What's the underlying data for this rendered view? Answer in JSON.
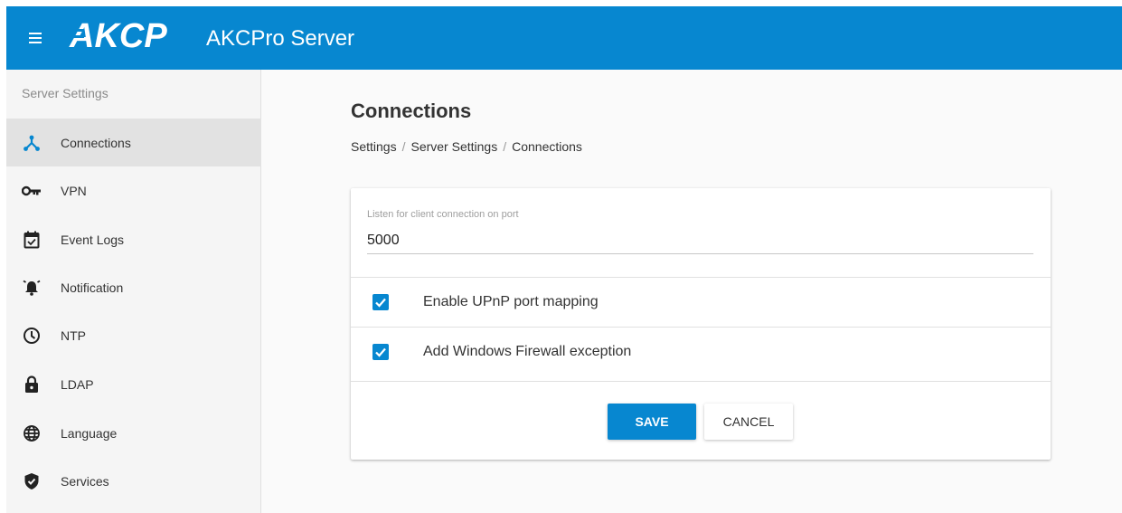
{
  "app": {
    "logo_text": "AKCP",
    "title": "AKCPro Server",
    "brand_color": "#0787d0"
  },
  "sidebar": {
    "header": "Server Settings",
    "items": [
      {
        "label": "Connections",
        "icon": "connections-icon",
        "active": true
      },
      {
        "label": "VPN",
        "icon": "key-icon",
        "active": false
      },
      {
        "label": "Event Logs",
        "icon": "calendar-check-icon",
        "active": false
      },
      {
        "label": "Notification",
        "icon": "alarm-bell-icon",
        "active": false
      },
      {
        "label": "NTP",
        "icon": "clock-icon",
        "active": false
      },
      {
        "label": "LDAP",
        "icon": "lock-icon",
        "active": false
      },
      {
        "label": "Language",
        "icon": "globe-icon",
        "active": false
      },
      {
        "label": "Services",
        "icon": "shield-check-icon",
        "active": false
      }
    ]
  },
  "main": {
    "title": "Connections",
    "breadcrumb": [
      "Settings",
      "Server Settings",
      "Connections"
    ],
    "breadcrumb_separator": "/",
    "port_field": {
      "label": "Listen for client connection on port",
      "value": "5000"
    },
    "options": [
      {
        "label": "Enable UPnP port mapping",
        "checked": true
      },
      {
        "label": "Add Windows Firewall exception",
        "checked": true
      }
    ],
    "save_label": "SAVE",
    "cancel_label": "CANCEL"
  }
}
